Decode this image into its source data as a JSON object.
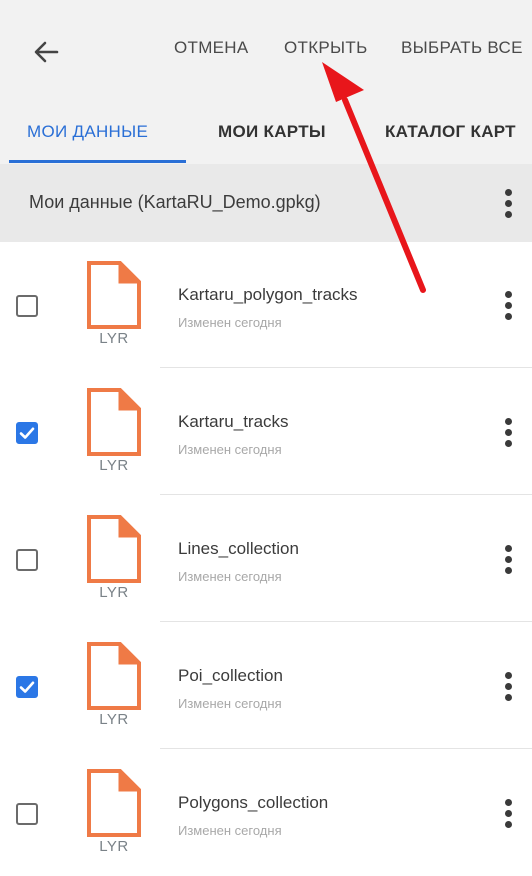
{
  "toolbar": {
    "back_icon": "arrow-left-icon",
    "cancel_label": "ОТМЕНА",
    "open_label": "ОТКРЫТЬ",
    "select_all_label": "ВЫБРАТЬ ВСЕ"
  },
  "tabs": [
    {
      "label": "МОИ ДАННЫЕ",
      "active": true
    },
    {
      "label": "МОИ КАРТЫ",
      "active": false
    },
    {
      "label": "КАТАЛОГ КАРТ",
      "active": false
    }
  ],
  "folder": {
    "title": "Мои данные (KartaRU_Demo.gpkg)"
  },
  "items": [
    {
      "name": "Kartaru_polygon_tracks",
      "subtitle": "Изменен сегодня",
      "type": "LYR",
      "checked": false
    },
    {
      "name": "Kartaru_tracks",
      "subtitle": "Изменен сегодня",
      "type": "LYR",
      "checked": true
    },
    {
      "name": "Lines_collection",
      "subtitle": "Изменен сегодня",
      "type": "LYR",
      "checked": false
    },
    {
      "name": "Poi_collection",
      "subtitle": "Изменен сегодня",
      "type": "LYR",
      "checked": true
    },
    {
      "name": "Polygons_collection",
      "subtitle": "Изменен сегодня",
      "type": "LYR",
      "checked": false
    }
  ],
  "colors": {
    "accent": "#2a6fd6",
    "checkbox_checked": "#2b77e6",
    "file_icon": "#ef7a46",
    "annotation_arrow": "#e8161b"
  }
}
